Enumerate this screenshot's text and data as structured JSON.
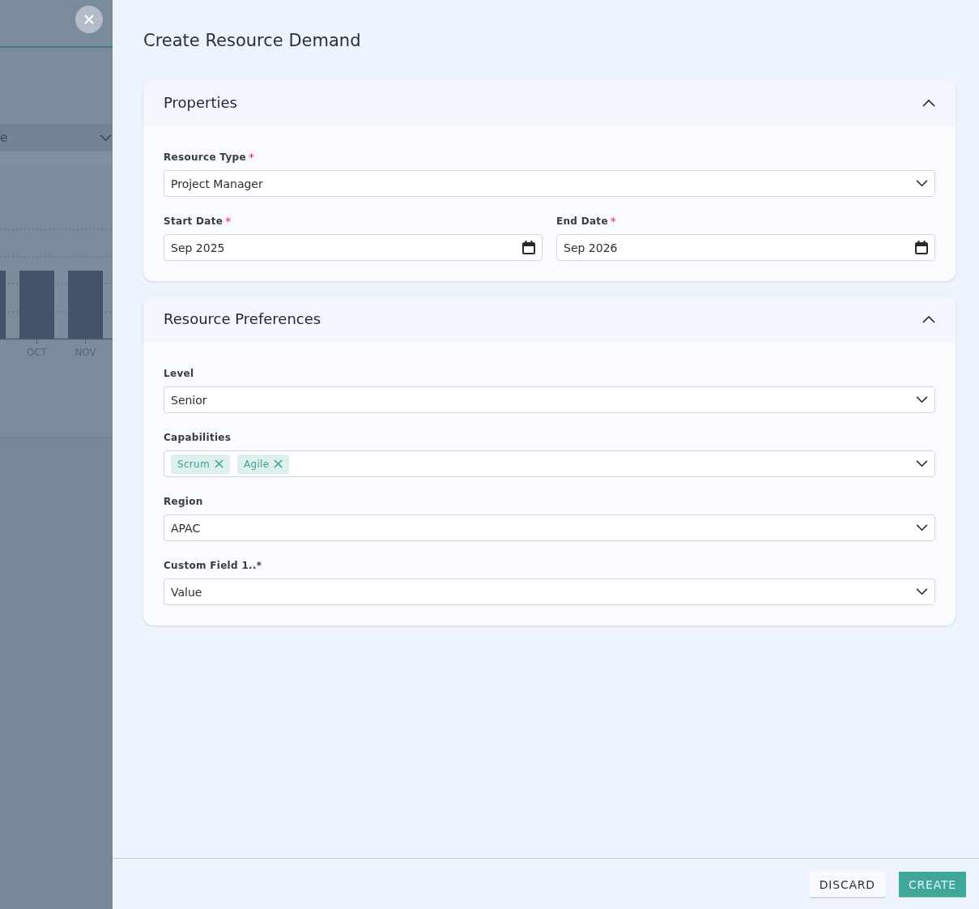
{
  "backdrop": {
    "dropdown_value": "e",
    "chart": {
      "categories": [
        "OCT",
        "NOV"
      ]
    }
  },
  "panel": {
    "title": "Create Resource Demand"
  },
  "sections": [
    {
      "title": "Properties",
      "expanded": true,
      "rows": [
        [
          {
            "kind": "select",
            "label": "Resource Type",
            "required_mark": "*",
            "value": "Project Manager"
          }
        ],
        [
          {
            "kind": "date",
            "label": "Start Date",
            "required_mark": "*",
            "value": "Sep 2025"
          },
          {
            "kind": "date",
            "label": "End Date",
            "required_mark": "*",
            "value": "Sep 2026"
          }
        ]
      ]
    },
    {
      "title": "Resource Preferences",
      "expanded": true,
      "rows": [
        [
          {
            "kind": "select",
            "label": "Level",
            "value": "Senior"
          }
        ],
        [
          {
            "kind": "tags",
            "label": "Capabilities",
            "tags": [
              "Scrum",
              "Agile"
            ]
          }
        ],
        [
          {
            "kind": "select",
            "label": "Region",
            "value": "APAC"
          }
        ],
        [
          {
            "kind": "select",
            "label": "Custom Field 1..*",
            "value": "Value"
          }
        ]
      ]
    }
  ],
  "footer": {
    "buttons": [
      {
        "label": "DISCARD",
        "kind": "secondary"
      },
      {
        "label": "CREATE",
        "kind": "primary"
      }
    ]
  }
}
